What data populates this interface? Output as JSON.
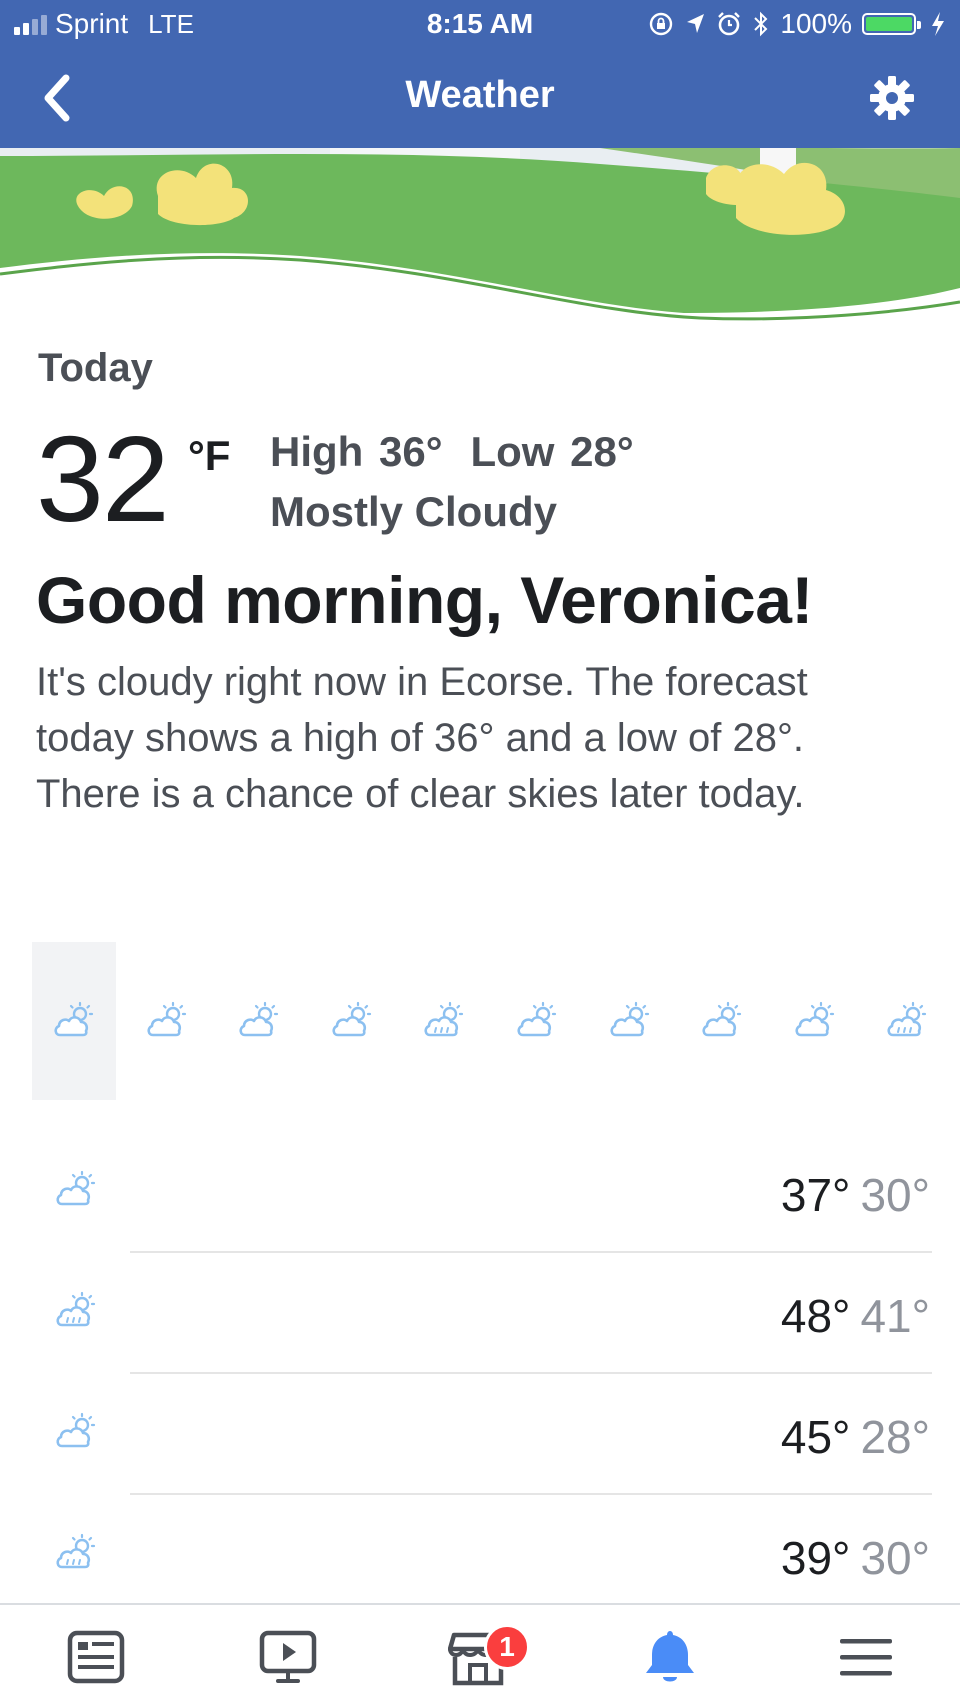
{
  "status_bar": {
    "carrier": "Sprint",
    "network": "LTE",
    "time": "8:15 AM",
    "battery_percent": "100%",
    "battery_level": 1.0,
    "signal_bars_filled": 2,
    "signal_bars_total": 4,
    "icons": [
      "orientation-lock-icon",
      "location-arrow-icon",
      "alarm-icon",
      "bluetooth-icon",
      "battery-icon",
      "charging-bolt-icon"
    ]
  },
  "header": {
    "title": "Weather",
    "back_icon": "chevron-left-icon",
    "settings_icon": "gear-icon"
  },
  "today": {
    "label": "Today",
    "temperature": "32",
    "unit": "°F",
    "high": "High 36°",
    "low": "Low 28°",
    "condition": "Mostly Cloudy",
    "greeting": "Good morning, Veronica!",
    "summary": "It's cloudy right now in Ecorse. The forecast today shows a high of 36° and a low of 28°. There is a chance of clear skies later today."
  },
  "hourly": [
    {
      "icon": "partly-cloudy-day-icon",
      "selected": true
    },
    {
      "icon": "partly-cloudy-day-icon",
      "selected": false
    },
    {
      "icon": "partly-cloudy-day-icon",
      "selected": false
    },
    {
      "icon": "partly-cloudy-day-icon",
      "selected": false
    },
    {
      "icon": "partly-cloudy-rain-icon",
      "selected": false
    },
    {
      "icon": "partly-cloudy-day-icon",
      "selected": false
    },
    {
      "icon": "partly-cloudy-day-icon",
      "selected": false
    },
    {
      "icon": "partly-cloudy-day-icon",
      "selected": false
    },
    {
      "icon": "partly-cloudy-day-icon",
      "selected": false
    },
    {
      "icon": "partly-cloudy-rain-icon",
      "selected": false
    }
  ],
  "daily": [
    {
      "icon": "partly-cloudy-day-icon",
      "high": "37°",
      "low": "30°"
    },
    {
      "icon": "partly-cloudy-rain-icon",
      "high": "48°",
      "low": "41°"
    },
    {
      "icon": "partly-cloudy-day-icon",
      "high": "45°",
      "low": "28°"
    },
    {
      "icon": "partly-cloudy-rain-icon",
      "high": "39°",
      "low": "30°"
    }
  ],
  "tab_bar": {
    "tabs": [
      {
        "name": "news-feed",
        "icon": "news-feed-icon",
        "active": false
      },
      {
        "name": "watch",
        "icon": "video-play-icon",
        "active": false
      },
      {
        "name": "marketplace",
        "icon": "marketplace-store-icon",
        "active": false,
        "badge": "1"
      },
      {
        "name": "notifications",
        "icon": "bell-icon",
        "active": true
      },
      {
        "name": "menu",
        "icon": "hamburger-menu-icon",
        "active": false
      }
    ],
    "marketplace_badge": "1"
  },
  "colors": {
    "header_blue": "#4267b2",
    "active_blue": "#4a8cf7",
    "icon_light_blue": "#8cc0f0",
    "grass_green": "#6db85c",
    "badge_red": "#fa3e3e",
    "secondary_text": "#4b4f56",
    "muted_text": "#90949c"
  }
}
